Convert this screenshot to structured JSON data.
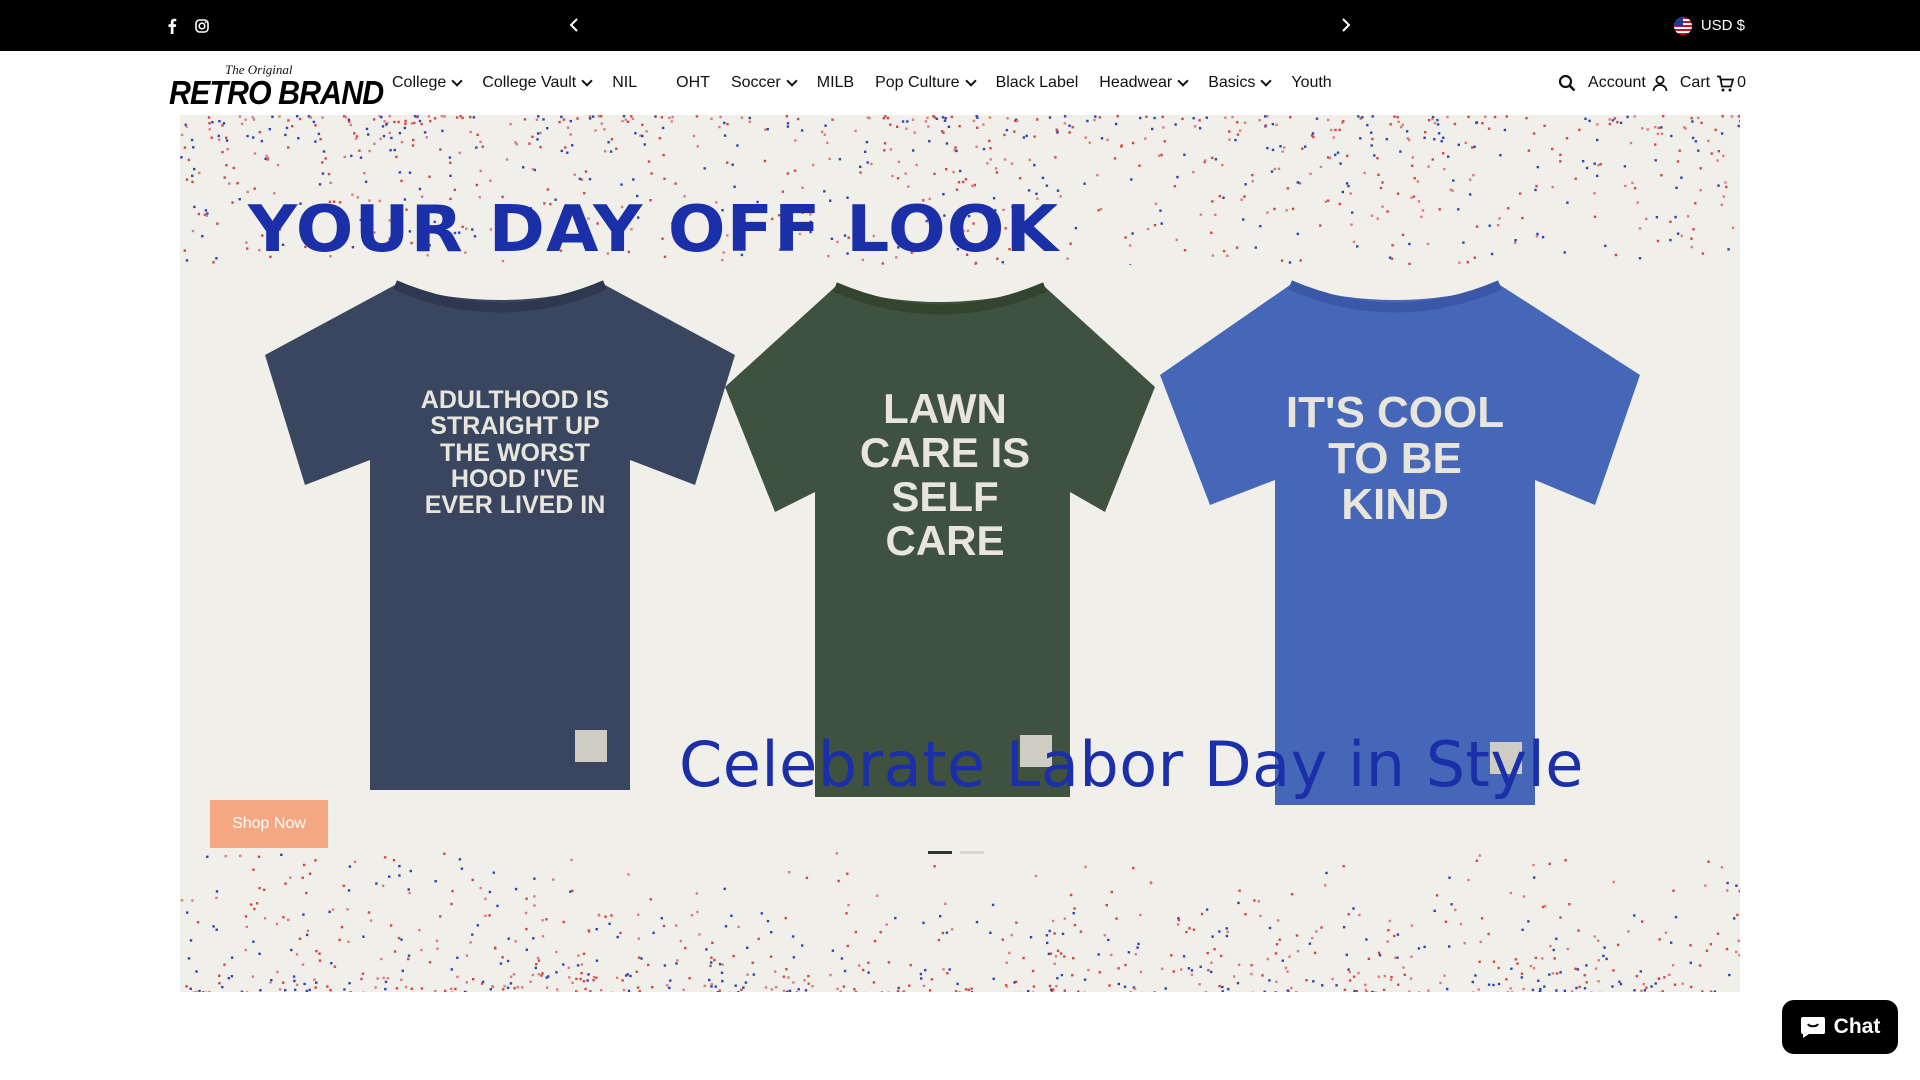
{
  "announcement": {
    "social_icons": [
      "facebook-icon",
      "instagram-icon"
    ],
    "prev_icon": "chevron-left-icon",
    "next_icon": "chevron-right-icon",
    "currency": "USD $"
  },
  "header": {
    "logo_small": "The Original",
    "logo_big": "RETRO BRAND",
    "nav": [
      {
        "label": "College",
        "dropdown": true
      },
      {
        "label": "College Vault",
        "dropdown": true
      },
      {
        "label": "NIL",
        "dropdown": false
      },
      {
        "label": "OHT",
        "dropdown": false
      },
      {
        "label": "Soccer",
        "dropdown": true
      },
      {
        "label": "MILB",
        "dropdown": false
      },
      {
        "label": "Pop Culture",
        "dropdown": true
      },
      {
        "label": "Black Label",
        "dropdown": false
      },
      {
        "label": "Headwear",
        "dropdown": true
      },
      {
        "label": "Basics",
        "dropdown": true
      },
      {
        "label": "Youth",
        "dropdown": false
      }
    ],
    "account_label": "Account",
    "cart_label": "Cart",
    "cart_count": "0"
  },
  "hero": {
    "headline": "YOUR DAY OFF LOOK",
    "subline": "Celebrate Labor Day in Style",
    "shirts": [
      {
        "text": "ADULTHOOD IS STRAIGHT UP THE WORST HOOD I'VE EVER LIVED IN",
        "color": "#3a4660"
      },
      {
        "text": "LAWN CARE IS SELF CARE",
        "color": "#3f5240"
      },
      {
        "text": "IT'S COOL TO BE KIND",
        "color": "#4666b8"
      }
    ],
    "cta": "Shop Now",
    "slide_count": 2,
    "active_slide": 1
  },
  "chat": {
    "label": "Chat"
  },
  "colors": {
    "topbar": "#000000",
    "headline": "#1a2fa8",
    "cta": "#f5a37a"
  }
}
